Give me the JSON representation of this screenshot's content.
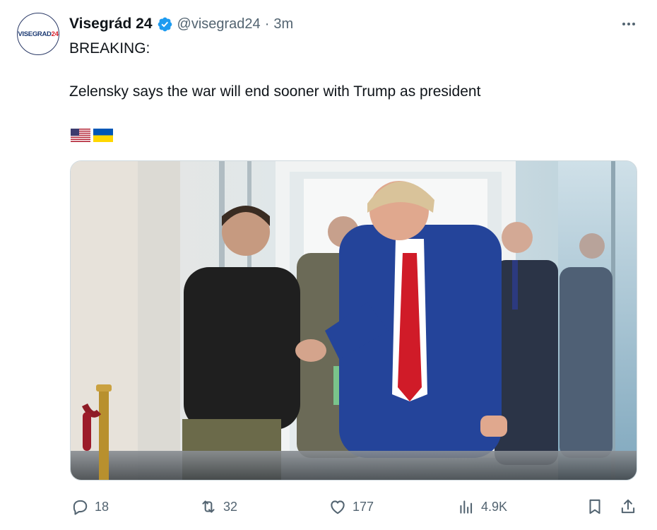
{
  "account": {
    "avatar_text_main": "VISEGRAD",
    "avatar_text_accent": "24",
    "display_name": "Visegrád 24",
    "handle": "@visegrad24",
    "separator": "·",
    "time_ago": "3m",
    "verified": true
  },
  "tweet": {
    "line1": "BREAKING:",
    "line2": "Zelensky says the war will end sooner with Trump as president",
    "flags": [
      "us-flag",
      "ukraine-flag"
    ]
  },
  "media": {
    "type": "photo",
    "subject": "handshake in a glass-walled hallway"
  },
  "actions": {
    "replies": "18",
    "reposts": "32",
    "likes": "177",
    "views": "4.9K"
  },
  "colors": {
    "text": "#0f1419",
    "secondary": "#536471",
    "verified_blue": "#1d9bf0",
    "border": "#cfd9de"
  }
}
